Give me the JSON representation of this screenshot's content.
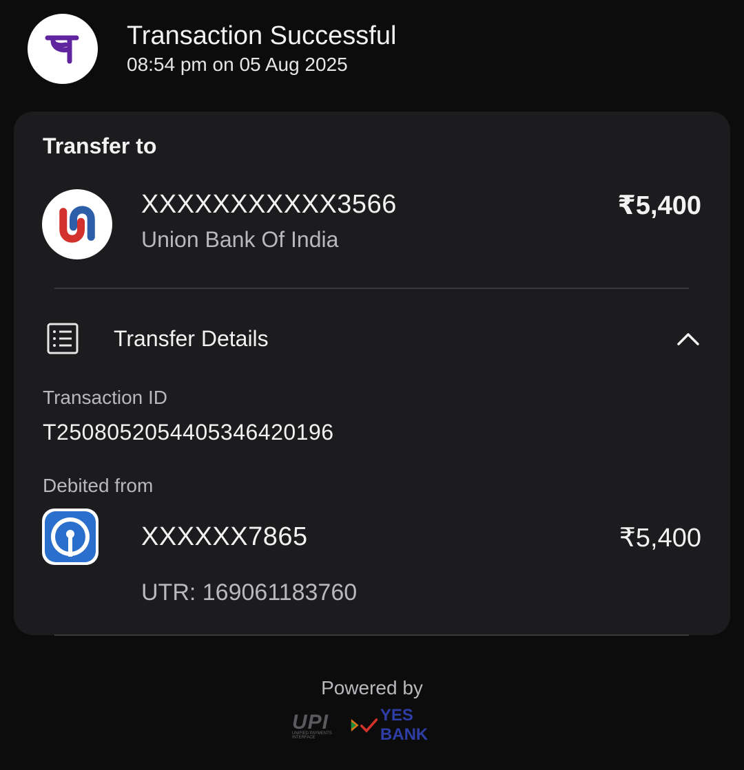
{
  "header": {
    "title": "Transaction Successful",
    "timestamp": "08:54 pm on 05 Aug 2025",
    "logo_icon": "phonepe-pe-icon"
  },
  "transfer_to": {
    "section_title": "Transfer to",
    "account": "XXXXXXXXXXX3566",
    "bank_name": "Union Bank Of India",
    "amount": "₹5,400",
    "bank_icon": "union-bank-logo-icon"
  },
  "transfer_details": {
    "label": "Transfer Details",
    "icon": "receipt-list-icon",
    "toggle_icon": "chevron-up-icon",
    "transaction_id_label": "Transaction ID",
    "transaction_id": "T2508052054405346420196",
    "debited_from_label": "Debited from",
    "debited_account": "XXXXXX7865",
    "debited_amount": "₹5,400",
    "utr": "UTR: 169061183760",
    "debit_bank_icon": "sbi-logo-icon"
  },
  "footer": {
    "powered_by": "Powered by",
    "upi_label": "UPI",
    "upi_sub": "UNIFIED PAYMENTS INTERFACE",
    "bank_label": "YES BANK"
  },
  "colors": {
    "background": "#0c0c0d",
    "card": "#1c1c1e",
    "phonepe_purple": "#5f259f",
    "union_red": "#d3322c",
    "union_blue": "#2c5fa8",
    "sbi_blue": "#2a6fcc"
  }
}
